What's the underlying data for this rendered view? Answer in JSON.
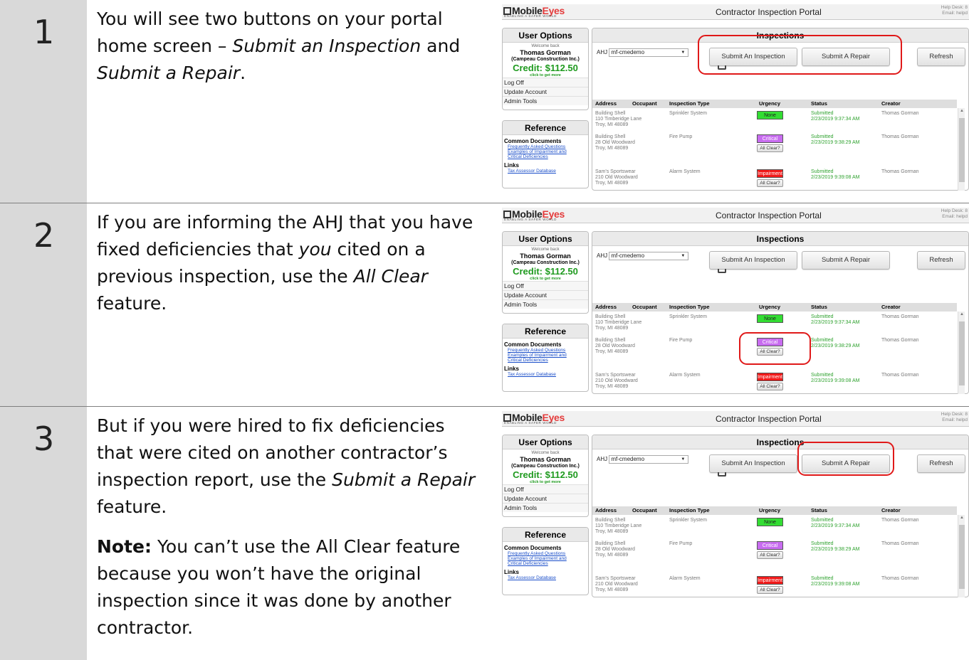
{
  "steps": [
    {
      "number": "1"
    },
    {
      "number": "2"
    },
    {
      "number": "3"
    }
  ],
  "step1": {
    "t1": "You will see two buttons on your portal home screen – ",
    "t2": "Submit an Inspection",
    "t3": " and ",
    "t4": "Submit a Repair",
    "t5": "."
  },
  "step2": {
    "t1": "If you are informing the AHJ that you have fixed deficiencies that ",
    "t2": "you",
    "t3": " cited on a previous inspection, use the ",
    "t4": "All Clear",
    "t5": " feature."
  },
  "step3": {
    "t1": "But if you were hired to fix deficiencies that were cited on another contractor’s inspection report, use the ",
    "t2": "Submit a Repair",
    "t3": " feature.",
    "note_label": "Note:",
    "note_text": " You can’t use the All Clear feature because you won’t have the original inspection since it was done by another contractor."
  },
  "portal": {
    "logo_mobile": "Mobile",
    "logo_eyes": "Eyes",
    "tagline": "ENABLING A SAFER WORLD",
    "title": "Contractor Inspection Portal",
    "help_line1": "Help Desk: 8",
    "help_line2": "Email: helpd",
    "user_options": "User Options",
    "welcome": "Welcome back",
    "user_name": "Thomas Gorman",
    "company": "(Campeau Construction Inc.)",
    "credit": "Credit: $112.50",
    "credit_note": "click to get more",
    "menu": [
      "Log Off",
      "Update Account",
      "Admin Tools"
    ],
    "reference": "Reference",
    "common_docs": "Common Documents",
    "doc_links": [
      "Frequently Asked Questions",
      "Examples of Impairment and",
      "Critical Deficiencies"
    ],
    "links": "Links",
    "link_items": [
      "Tax Assessor Database"
    ],
    "inspections": "Inspections",
    "ahj_label": "AHJ",
    "ahj_value": "mf-cmedemo",
    "btn_inspection": "Submit An Inspection",
    "btn_repair": "Submit A Repair",
    "btn_refresh": "Refresh",
    "columns": [
      "Address",
      "Occupant",
      "Inspection Type",
      "Urgency",
      "Status",
      "Creator"
    ],
    "rows": [
      {
        "addr1": "Building Shell",
        "addr2": "110 Timberidge Lane",
        "addr3": "Troy, MI 48089",
        "type": "Sprinkler System",
        "urgency": "None",
        "status1": "Submitted",
        "status2": "2/23/2019 9:37:34 AM",
        "creator": "Thomas Gorman"
      },
      {
        "addr1": "Building Shell",
        "addr2": "28 Old Woodward",
        "addr3": "Troy, MI 48089",
        "type": "Fire Pump",
        "urgency": "Critical",
        "all_clear": "All Clear?",
        "status1": "Submitted",
        "status2": "2/23/2019 9:38:29 AM",
        "creator": "Thomas Gorman"
      },
      {
        "addr1": "Sam's Sportswear",
        "addr2": "210 Old Woodward",
        "addr3": "Troy, MI 48089",
        "type": "Alarm System",
        "urgency": "Impairment",
        "all_clear": "All Clear?",
        "status1": "Submitted",
        "status2": "2/23/2019 9:39:08 AM",
        "creator": "Thomas Gorman"
      }
    ]
  },
  "colors": {
    "accent_red": "#e01919",
    "credit_green": "#1e9a1e",
    "step_gray": "#d9d9d9"
  }
}
